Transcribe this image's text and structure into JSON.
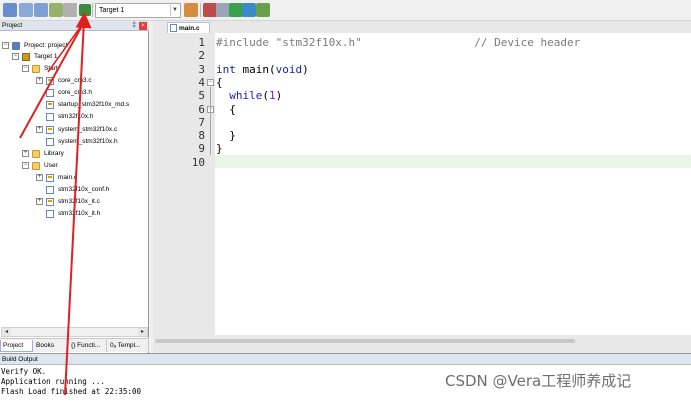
{
  "toolbar": {
    "target_value": "Target 1"
  },
  "project_panel": {
    "title": "Project",
    "pin_glyph": "‡",
    "close_glyph": "×",
    "tree": [
      {
        "label": "Project: project",
        "icon": "project-icon",
        "expander": "−"
      },
      {
        "label": "Target 1",
        "icon": "target-icon",
        "expander": "−"
      },
      {
        "label": "Start",
        "icon": "folder-icon",
        "expander": "−"
      },
      {
        "label": "core_cm3.c",
        "icon": "c-file-icon",
        "expander": "+"
      },
      {
        "label": "core_cm3.h",
        "icon": "h-file-icon",
        "expander": ""
      },
      {
        "label": "startup_stm32f10x_md.s",
        "icon": "asm-file-icon",
        "expander": ""
      },
      {
        "label": "stm32f10x.h",
        "icon": "h-file-icon",
        "expander": ""
      },
      {
        "label": "system_stm32f10x.c",
        "icon": "c-file-icon",
        "expander": "+"
      },
      {
        "label": "system_stm32f10x.h",
        "icon": "h-file-icon",
        "expander": ""
      },
      {
        "label": "Library",
        "icon": "folder-icon",
        "expander": "+"
      },
      {
        "label": "User",
        "icon": "folder-icon",
        "expander": "−"
      },
      {
        "label": "main.c",
        "icon": "c-file-icon",
        "expander": "+"
      },
      {
        "label": "stm32f10x_conf.h",
        "icon": "h-file-icon",
        "expander": ""
      },
      {
        "label": "stm32f10x_it.c",
        "icon": "c-file-icon",
        "expander": "+"
      },
      {
        "label": "stm32f10x_it.h",
        "icon": "h-file-icon",
        "expander": ""
      }
    ],
    "tabs": [
      "Project",
      "Books",
      "{} Functi...",
      "0ₐ Templ..."
    ]
  },
  "editor": {
    "active_tab": "main.c",
    "lines": [
      {
        "n": "1",
        "pre": "#include ",
        "str": "\"stm32f10x.h\"",
        "pad": "                 ",
        "com": "// Device header"
      },
      {
        "n": "2"
      },
      {
        "n": "3",
        "type": "int",
        "text": " main(",
        "type2": "void",
        "text2": ")"
      },
      {
        "n": "4",
        "text": "{"
      },
      {
        "n": "5",
        "text": "  ",
        "kw": "while",
        "text2": "(",
        "num": "1",
        "text3": ")"
      },
      {
        "n": "6",
        "text": "  {"
      },
      {
        "n": "7"
      },
      {
        "n": "8",
        "text": "  }"
      },
      {
        "n": "9",
        "text": "}"
      },
      {
        "n": "10"
      }
    ]
  },
  "build_output": {
    "title": "Build Output",
    "lines": [
      "Verify OK.",
      "Application running ...",
      "Flash Load finished at 22:35:00"
    ]
  },
  "watermark": "CSDN @Vera工程师养成记",
  "colors": {
    "annotation_red": "#e02020",
    "highlight_line": "#e8f6e8",
    "folder": "#f3cf62"
  }
}
